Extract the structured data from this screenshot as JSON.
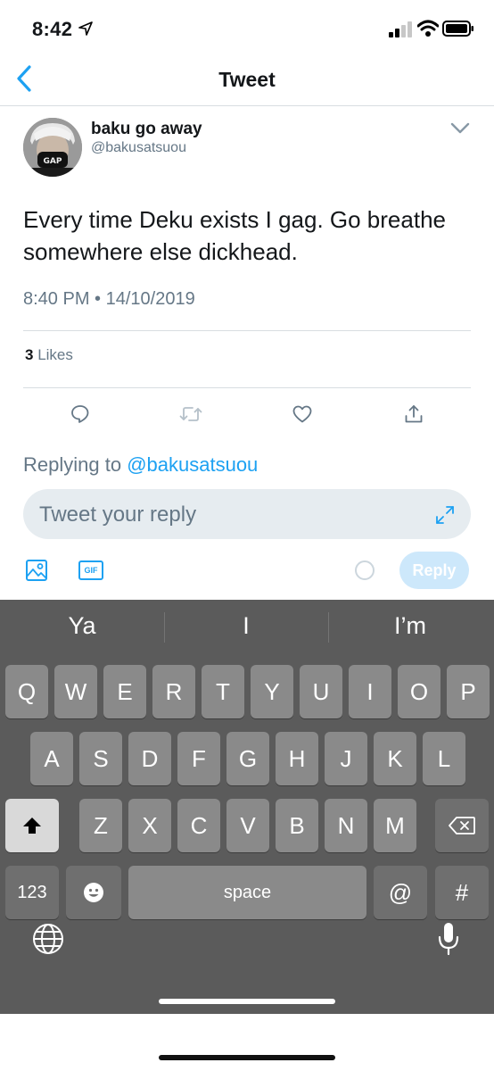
{
  "status_bar": {
    "time": "8:42"
  },
  "nav": {
    "title": "Tweet"
  },
  "tweet": {
    "display_name": "baku go away",
    "handle": "@bakusatsuou",
    "text": "Every time Deku exists I gag. Go breathe somewhere else dickhead.",
    "timestamp": "8:40 PM • 14/10/2019",
    "likes_count": "3",
    "likes_label": "Likes"
  },
  "composer": {
    "replying_prefix": "Replying to",
    "replying_to": "@bakusatsuou",
    "placeholder": "Tweet your reply",
    "gif_label": "GIF",
    "reply_label": "Reply"
  },
  "keyboard": {
    "suggestions": [
      "Ya",
      "I",
      "I’m"
    ],
    "row1": [
      "Q",
      "W",
      "E",
      "R",
      "T",
      "Y",
      "U",
      "I",
      "O",
      "P"
    ],
    "row2": [
      "A",
      "S",
      "D",
      "F",
      "G",
      "H",
      "J",
      "K",
      "L"
    ],
    "row3": [
      "Z",
      "X",
      "C",
      "V",
      "B",
      "N",
      "M"
    ],
    "numbers_label": "123",
    "space_label": "space",
    "at_label": "@",
    "hash_label": "#"
  },
  "colors": {
    "accent": "#1da1f2",
    "secondary_text": "#657786",
    "keyboard_bg": "#5b5b5b"
  }
}
